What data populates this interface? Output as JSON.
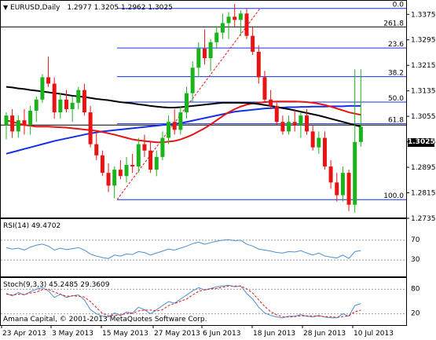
{
  "main": {
    "header": {
      "symbol": "EURUSD,Daily",
      "ohlc": "1.2977 1.3205 1.2962 1.3025"
    },
    "current_price": "1.3025",
    "price_ticks": [
      "1.3375",
      "1.3295",
      "1.3215",
      "1.3135",
      "1.3055",
      "1.2975",
      "1.2895",
      "1.2815",
      "1.2735"
    ],
    "fib_levels": [
      {
        "label": "0.0",
        "price": 1.3396
      },
      {
        "label": "261.8",
        "price": 1.3338
      },
      {
        "label": "23.6",
        "price": 1.3272
      },
      {
        "label": "38.2",
        "price": 1.3182
      },
      {
        "label": "50.0",
        "price": 1.3102
      },
      {
        "label": "61.8",
        "price": 1.3034
      },
      {
        "label": "100.0",
        "price": 1.2796
      }
    ]
  },
  "rsi": {
    "header": "RSI(14) 49.4702",
    "ticks": [
      "70",
      "30"
    ]
  },
  "stoch": {
    "header": "Stoch(9,3,3) 45.2485 29.3609",
    "ticks": [
      "80",
      "20"
    ]
  },
  "x_labels": [
    "23 Apr 2013",
    "3 May 2013",
    "15 May 2013",
    "27 May 2013",
    "6 Jun 2013",
    "18 Jun 2013",
    "28 Jun 2013",
    "10 Jul 2013"
  ],
  "copyright": "Amana Capital, © 2001-2013 MetaQuotes Software Corp.",
  "colors": {
    "bull": "#1bb31b",
    "bear": "#e81414",
    "ma_black": "#000000",
    "ma_red": "#e81414",
    "ma_blue": "#1530e8",
    "indicator": "#4a8fd0",
    "signal": "#e81414"
  },
  "chart_data": {
    "type": "candlestick",
    "title": "EURUSD,Daily",
    "ylim": [
      1.2735,
      1.342
    ],
    "candles": [
      [
        1.303,
        1.307,
        1.2985,
        1.306
      ],
      [
        1.306,
        1.308,
        1.299,
        1.301
      ],
      [
        1.301,
        1.306,
        1.299,
        1.3045
      ],
      [
        1.3045,
        1.308,
        1.3,
        1.303
      ],
      [
        1.303,
        1.309,
        1.3,
        1.3075
      ],
      [
        1.3075,
        1.312,
        1.304,
        1.311
      ],
      [
        1.311,
        1.319,
        1.31,
        1.318
      ],
      [
        1.318,
        1.3245,
        1.315,
        1.316
      ],
      [
        1.316,
        1.318,
        1.305,
        1.307
      ],
      [
        1.307,
        1.313,
        1.305,
        1.311
      ],
      [
        1.311,
        1.314,
        1.307,
        1.308
      ],
      [
        1.308,
        1.312,
        1.304,
        1.31
      ],
      [
        1.31,
        1.315,
        1.308,
        1.314
      ],
      [
        1.314,
        1.316,
        1.306,
        1.307
      ],
      [
        1.307,
        1.309,
        1.296,
        1.297
      ],
      [
        1.297,
        1.301,
        1.292,
        1.2935
      ],
      [
        1.2935,
        1.295,
        1.287,
        1.288
      ],
      [
        1.288,
        1.291,
        1.282,
        1.284
      ],
      [
        1.284,
        1.29,
        1.28,
        1.289
      ],
      [
        1.289,
        1.292,
        1.286,
        1.287
      ],
      [
        1.287,
        1.293,
        1.285,
        1.2905
      ],
      [
        1.2905,
        1.294,
        1.288,
        1.29
      ],
      [
        1.29,
        1.299,
        1.288,
        1.297
      ],
      [
        1.297,
        1.3,
        1.293,
        1.295
      ],
      [
        1.295,
        1.298,
        1.288,
        1.289
      ],
      [
        1.289,
        1.295,
        1.287,
        1.293
      ],
      [
        1.293,
        1.301,
        1.292,
        1.299
      ],
      [
        1.299,
        1.306,
        1.297,
        1.304
      ],
      [
        1.304,
        1.308,
        1.3,
        1.3015
      ],
      [
        1.3015,
        1.309,
        1.3,
        1.307
      ],
      [
        1.307,
        1.315,
        1.305,
        1.313
      ],
      [
        1.313,
        1.323,
        1.31,
        1.321
      ],
      [
        1.321,
        1.329,
        1.318,
        1.327
      ],
      [
        1.327,
        1.333,
        1.322,
        1.324
      ],
      [
        1.324,
        1.33,
        1.32,
        1.329
      ],
      [
        1.329,
        1.334,
        1.327,
        1.332
      ],
      [
        1.332,
        1.338,
        1.33,
        1.335
      ],
      [
        1.335,
        1.3385,
        1.33,
        1.337
      ],
      [
        1.337,
        1.341,
        1.334,
        1.336
      ],
      [
        1.336,
        1.339,
        1.331,
        1.338
      ],
      [
        1.338,
        1.3396,
        1.33,
        1.331
      ],
      [
        1.331,
        1.334,
        1.325,
        1.326
      ],
      [
        1.326,
        1.328,
        1.316,
        1.318
      ],
      [
        1.318,
        1.32,
        1.31,
        1.311
      ],
      [
        1.311,
        1.314,
        1.308,
        1.309
      ],
      [
        1.309,
        1.31,
        1.303,
        1.304
      ],
      [
        1.304,
        1.306,
        1.3,
        1.301
      ],
      [
        1.301,
        1.306,
        1.3,
        1.304
      ],
      [
        1.304,
        1.308,
        1.301,
        1.303
      ],
      [
        1.303,
        1.307,
        1.299,
        1.306
      ],
      [
        1.306,
        1.308,
        1.3,
        1.301
      ],
      [
        1.301,
        1.303,
        1.295,
        1.296
      ],
      [
        1.296,
        1.301,
        1.294,
        1.299
      ],
      [
        1.299,
        1.301,
        1.289,
        1.29
      ],
      [
        1.29,
        1.292,
        1.283,
        1.285
      ],
      [
        1.285,
        1.288,
        1.279,
        1.281
      ],
      [
        1.281,
        1.29,
        1.279,
        1.288
      ],
      [
        1.288,
        1.289,
        1.276,
        1.278
      ],
      [
        1.278,
        1.3205,
        1.2755,
        1.2977
      ],
      [
        1.2977,
        1.3205,
        1.2962,
        1.3025
      ]
    ],
    "ma_black": [
      1.315,
      1.3148,
      1.3145,
      1.3143,
      1.314,
      1.3138,
      1.3135,
      1.3133,
      1.313,
      1.3128,
      1.3125,
      1.3122,
      1.312,
      1.3118,
      1.3115,
      1.3112,
      1.311,
      1.3108,
      1.3105,
      1.3102,
      1.31,
      1.3098,
      1.3095,
      1.3093,
      1.309,
      1.3088,
      1.3086,
      1.3085,
      1.3085,
      1.3086,
      1.3088,
      1.309,
      1.3092,
      1.3094,
      1.3096,
      1.3098,
      1.31,
      1.31,
      1.31,
      1.31,
      1.3099,
      1.3098,
      1.3096,
      1.3093,
      1.309,
      1.3087,
      1.3083,
      1.308,
      1.3076,
      1.3072,
      1.3068,
      1.3064,
      1.306,
      1.3055,
      1.305,
      1.3045,
      1.304,
      1.3035,
      1.303,
      1.3025
    ],
    "ma_red": [
      1.3045,
      1.304,
      1.3035,
      1.303,
      1.3028,
      1.3025,
      1.3025,
      1.3025,
      1.3024,
      1.3023,
      1.3022,
      1.302,
      1.3018,
      1.3016,
      1.3014,
      1.3012,
      1.3008,
      1.3004,
      1.3,
      1.2995,
      1.299,
      1.2985,
      1.2982,
      1.298,
      1.2978,
      1.2976,
      1.2976,
      1.2978,
      1.298,
      1.2985,
      1.2992,
      1.3,
      1.301,
      1.302,
      1.3032,
      1.3045,
      1.3058,
      1.307,
      1.308,
      1.3088,
      1.3094,
      1.3098,
      1.31,
      1.3102,
      1.3103,
      1.3104,
      1.3104,
      1.3104,
      1.3104,
      1.3103,
      1.3102,
      1.31,
      1.3097,
      1.3093,
      1.3088,
      1.3082,
      1.3076,
      1.307,
      1.3066,
      1.3062
    ],
    "ma_blue": [
      1.294,
      1.2945,
      1.295,
      1.2955,
      1.296,
      1.2965,
      1.297,
      1.2975,
      1.298,
      1.2984,
      1.2988,
      1.2992,
      1.2996,
      1.3,
      1.3004,
      1.3007,
      1.301,
      1.3012,
      1.3014,
      1.3016,
      1.3018,
      1.302,
      1.3022,
      1.3024,
      1.3026,
      1.3028,
      1.303,
      1.3032,
      1.3034,
      1.3036,
      1.304,
      1.3044,
      1.3048,
      1.3052,
      1.3056,
      1.306,
      1.3064,
      1.3068,
      1.3072,
      1.3074,
      1.3076,
      1.3078,
      1.308,
      1.3082,
      1.3083,
      1.3084,
      1.3085,
      1.3086,
      1.3086,
      1.3087,
      1.3087,
      1.3088,
      1.3088,
      1.3088,
      1.3089,
      1.3089,
      1.3089,
      1.309,
      1.309,
      1.309
    ],
    "rsi": [
      55,
      52,
      54,
      50,
      56,
      60,
      62,
      58,
      50,
      54,
      51,
      53,
      55,
      50,
      42,
      38,
      35,
      33,
      40,
      38,
      42,
      41,
      47,
      45,
      40,
      44,
      48,
      52,
      50,
      54,
      58,
      63,
      66,
      62,
      65,
      68,
      70,
      71,
      69,
      70,
      62,
      58,
      52,
      50,
      48,
      45,
      44,
      47,
      46,
      49,
      44,
      40,
      44,
      38,
      36,
      34,
      40,
      33,
      47,
      49
    ],
    "stoch_k": [
      70,
      64,
      72,
      66,
      74,
      80,
      84,
      76,
      60,
      68,
      60,
      64,
      66,
      54,
      30,
      20,
      14,
      12,
      22,
      16,
      24,
      22,
      36,
      30,
      20,
      30,
      40,
      50,
      46,
      56,
      66,
      76,
      84,
      78,
      82,
      86,
      88,
      90,
      86,
      88,
      70,
      56,
      36,
      22,
      16,
      12,
      10,
      14,
      14,
      18,
      14,
      12,
      16,
      12,
      10,
      10,
      20,
      14,
      40,
      45
    ],
    "stoch_d": [
      68,
      66,
      68,
      67,
      71,
      73,
      79,
      80,
      73,
      68,
      63,
      64,
      63,
      61,
      50,
      35,
      21,
      15,
      16,
      17,
      21,
      21,
      27,
      29,
      29,
      27,
      30,
      40,
      45,
      51,
      56,
      66,
      75,
      79,
      81,
      82,
      85,
      88,
      88,
      88,
      81,
      71,
      54,
      38,
      25,
      17,
      13,
      12,
      13,
      15,
      15,
      15,
      14,
      13,
      13,
      11,
      13,
      15,
      25,
      29
    ]
  }
}
